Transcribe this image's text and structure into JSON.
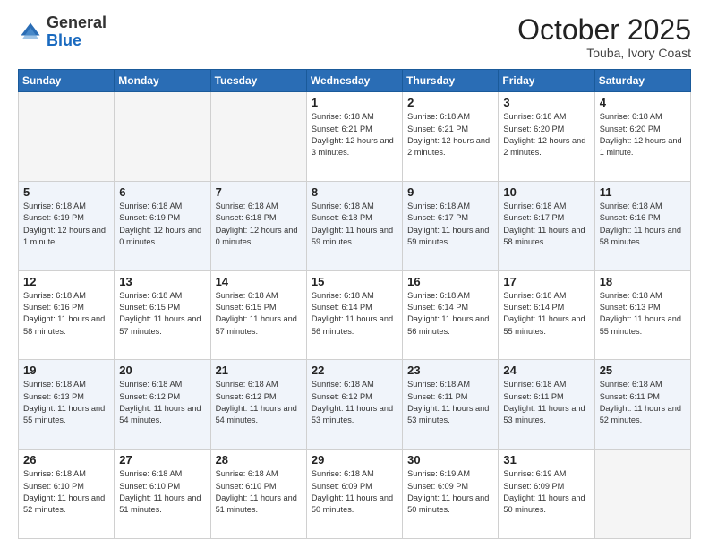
{
  "logo": {
    "general": "General",
    "blue": "Blue"
  },
  "header": {
    "month": "October 2025",
    "location": "Touba, Ivory Coast"
  },
  "weekdays": [
    "Sunday",
    "Monday",
    "Tuesday",
    "Wednesday",
    "Thursday",
    "Friday",
    "Saturday"
  ],
  "weeks": [
    [
      {
        "day": "",
        "info": ""
      },
      {
        "day": "",
        "info": ""
      },
      {
        "day": "",
        "info": ""
      },
      {
        "day": "1",
        "info": "Sunrise: 6:18 AM\nSunset: 6:21 PM\nDaylight: 12 hours and 3 minutes."
      },
      {
        "day": "2",
        "info": "Sunrise: 6:18 AM\nSunset: 6:21 PM\nDaylight: 12 hours and 2 minutes."
      },
      {
        "day": "3",
        "info": "Sunrise: 6:18 AM\nSunset: 6:20 PM\nDaylight: 12 hours and 2 minutes."
      },
      {
        "day": "4",
        "info": "Sunrise: 6:18 AM\nSunset: 6:20 PM\nDaylight: 12 hours and 1 minute."
      }
    ],
    [
      {
        "day": "5",
        "info": "Sunrise: 6:18 AM\nSunset: 6:19 PM\nDaylight: 12 hours and 1 minute."
      },
      {
        "day": "6",
        "info": "Sunrise: 6:18 AM\nSunset: 6:19 PM\nDaylight: 12 hours and 0 minutes."
      },
      {
        "day": "7",
        "info": "Sunrise: 6:18 AM\nSunset: 6:18 PM\nDaylight: 12 hours and 0 minutes."
      },
      {
        "day": "8",
        "info": "Sunrise: 6:18 AM\nSunset: 6:18 PM\nDaylight: 11 hours and 59 minutes."
      },
      {
        "day": "9",
        "info": "Sunrise: 6:18 AM\nSunset: 6:17 PM\nDaylight: 11 hours and 59 minutes."
      },
      {
        "day": "10",
        "info": "Sunrise: 6:18 AM\nSunset: 6:17 PM\nDaylight: 11 hours and 58 minutes."
      },
      {
        "day": "11",
        "info": "Sunrise: 6:18 AM\nSunset: 6:16 PM\nDaylight: 11 hours and 58 minutes."
      }
    ],
    [
      {
        "day": "12",
        "info": "Sunrise: 6:18 AM\nSunset: 6:16 PM\nDaylight: 11 hours and 58 minutes."
      },
      {
        "day": "13",
        "info": "Sunrise: 6:18 AM\nSunset: 6:15 PM\nDaylight: 11 hours and 57 minutes."
      },
      {
        "day": "14",
        "info": "Sunrise: 6:18 AM\nSunset: 6:15 PM\nDaylight: 11 hours and 57 minutes."
      },
      {
        "day": "15",
        "info": "Sunrise: 6:18 AM\nSunset: 6:14 PM\nDaylight: 11 hours and 56 minutes."
      },
      {
        "day": "16",
        "info": "Sunrise: 6:18 AM\nSunset: 6:14 PM\nDaylight: 11 hours and 56 minutes."
      },
      {
        "day": "17",
        "info": "Sunrise: 6:18 AM\nSunset: 6:14 PM\nDaylight: 11 hours and 55 minutes."
      },
      {
        "day": "18",
        "info": "Sunrise: 6:18 AM\nSunset: 6:13 PM\nDaylight: 11 hours and 55 minutes."
      }
    ],
    [
      {
        "day": "19",
        "info": "Sunrise: 6:18 AM\nSunset: 6:13 PM\nDaylight: 11 hours and 55 minutes."
      },
      {
        "day": "20",
        "info": "Sunrise: 6:18 AM\nSunset: 6:12 PM\nDaylight: 11 hours and 54 minutes."
      },
      {
        "day": "21",
        "info": "Sunrise: 6:18 AM\nSunset: 6:12 PM\nDaylight: 11 hours and 54 minutes."
      },
      {
        "day": "22",
        "info": "Sunrise: 6:18 AM\nSunset: 6:12 PM\nDaylight: 11 hours and 53 minutes."
      },
      {
        "day": "23",
        "info": "Sunrise: 6:18 AM\nSunset: 6:11 PM\nDaylight: 11 hours and 53 minutes."
      },
      {
        "day": "24",
        "info": "Sunrise: 6:18 AM\nSunset: 6:11 PM\nDaylight: 11 hours and 53 minutes."
      },
      {
        "day": "25",
        "info": "Sunrise: 6:18 AM\nSunset: 6:11 PM\nDaylight: 11 hours and 52 minutes."
      }
    ],
    [
      {
        "day": "26",
        "info": "Sunrise: 6:18 AM\nSunset: 6:10 PM\nDaylight: 11 hours and 52 minutes."
      },
      {
        "day": "27",
        "info": "Sunrise: 6:18 AM\nSunset: 6:10 PM\nDaylight: 11 hours and 51 minutes."
      },
      {
        "day": "28",
        "info": "Sunrise: 6:18 AM\nSunset: 6:10 PM\nDaylight: 11 hours and 51 minutes."
      },
      {
        "day": "29",
        "info": "Sunrise: 6:18 AM\nSunset: 6:09 PM\nDaylight: 11 hours and 50 minutes."
      },
      {
        "day": "30",
        "info": "Sunrise: 6:19 AM\nSunset: 6:09 PM\nDaylight: 11 hours and 50 minutes."
      },
      {
        "day": "31",
        "info": "Sunrise: 6:19 AM\nSunset: 6:09 PM\nDaylight: 11 hours and 50 minutes."
      },
      {
        "day": "",
        "info": ""
      }
    ]
  ]
}
